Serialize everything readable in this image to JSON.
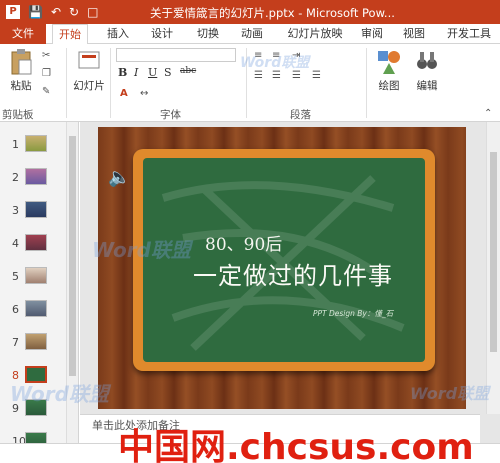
{
  "titlebar": {
    "title": "关于爱情箴言的幻灯片.pptx - Microsoft Pow...",
    "qa_icons": [
      "powerpoint-icon",
      "save-icon",
      "undo-icon",
      "redo-icon",
      "present-icon"
    ]
  },
  "tabs": [
    "文件",
    "开始",
    "插入",
    "设计",
    "切换",
    "动画",
    "幻灯片放映",
    "审阅",
    "视图",
    "开发工具"
  ],
  "ribbon": {
    "paste_label": "粘贴",
    "slide_label": "幻灯片",
    "draw_label": "绘图",
    "edit_label": "编辑",
    "groups": [
      "剪贴板",
      "字体",
      "段落"
    ],
    "font_buttons": [
      "B",
      "I",
      "U",
      "S",
      "abc"
    ]
  },
  "thumbnails": [
    "1",
    "2",
    "3",
    "4",
    "5",
    "6",
    "7",
    "8",
    "9",
    "10"
  ],
  "selected_slide": "8",
  "slide": {
    "line1": "80、90后",
    "line2": "一定做过的几件事",
    "credit": "PPT Design By：懂_石"
  },
  "notes_placeholder": "单击此处添加备注",
  "watermark": {
    "site": "中国网.chcsus.com",
    "word_logo": "Word联盟"
  },
  "colors": {
    "accent": "#c43e1c",
    "board": "#2f6b3f",
    "frame": "#e08a2c"
  }
}
